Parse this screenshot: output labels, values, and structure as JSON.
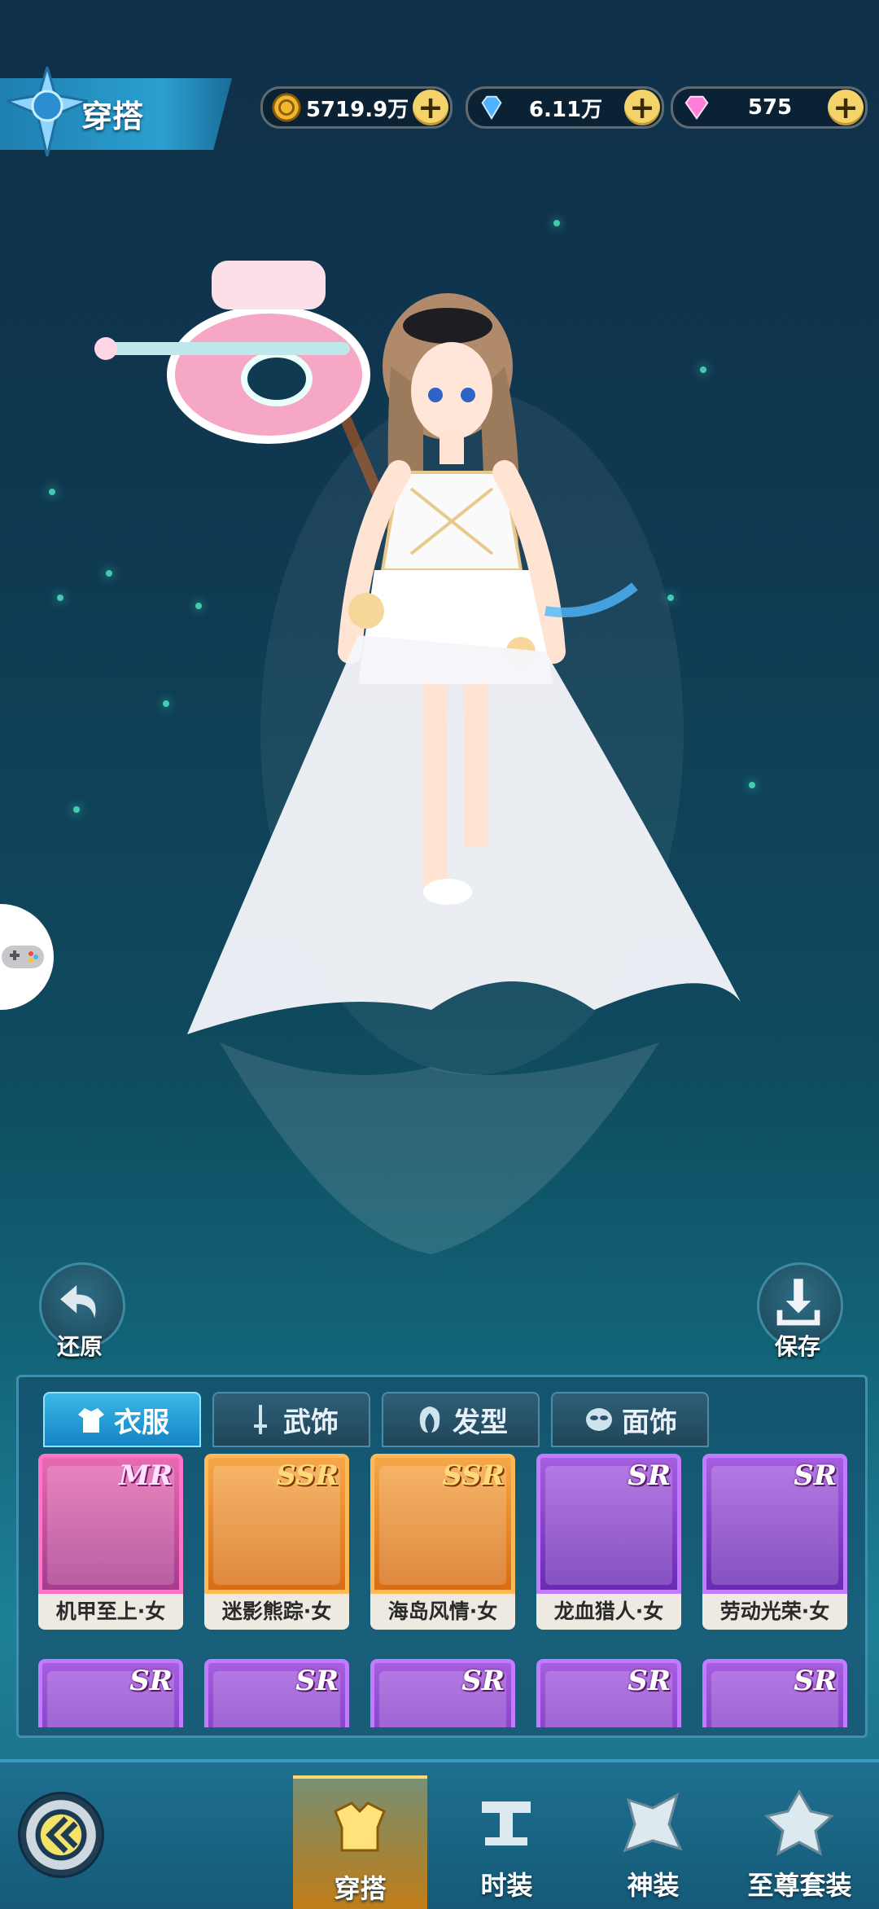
{
  "header": {
    "title": "穿搭"
  },
  "currencies": [
    {
      "icon": "gold-coin-icon",
      "value": "5719.9万"
    },
    {
      "icon": "blue-diamond-icon",
      "value": "6.11万"
    },
    {
      "icon": "pink-diamond-icon",
      "value": "575"
    }
  ],
  "actions": {
    "restore_label": "还原",
    "save_label": "保存"
  },
  "tabs": [
    {
      "label": "衣服",
      "icon": "clothes-icon",
      "active": true
    },
    {
      "label": "武饰",
      "icon": "sword-icon",
      "active": false
    },
    {
      "label": "发型",
      "icon": "hair-icon",
      "active": false
    },
    {
      "label": "面饰",
      "icon": "mask-icon",
      "active": false
    }
  ],
  "items": [
    {
      "name": "机甲至上·女",
      "rarity": "MR"
    },
    {
      "name": "迷影熊踪·女",
      "rarity": "SSR"
    },
    {
      "name": "海岛风情·女",
      "rarity": "SSR"
    },
    {
      "name": "龙血猎人·女",
      "rarity": "SR"
    },
    {
      "name": "劳动光荣·女",
      "rarity": "SR"
    },
    {
      "name": "",
      "rarity": "SR"
    },
    {
      "name": "",
      "rarity": "SR"
    },
    {
      "name": "",
      "rarity": "SR"
    },
    {
      "name": "",
      "rarity": "SR"
    },
    {
      "name": "",
      "rarity": "SR"
    }
  ],
  "bottom_nav": [
    {
      "label": "穿搭",
      "active": true
    },
    {
      "label": "时装",
      "active": false
    },
    {
      "label": "神装",
      "active": false
    },
    {
      "label": "至尊套装",
      "active": false
    }
  ],
  "colors": {
    "accent": "#2ba0d0",
    "mr": "#ff74c6",
    "ssr": "#ffba57",
    "sr": "#c07bff"
  }
}
